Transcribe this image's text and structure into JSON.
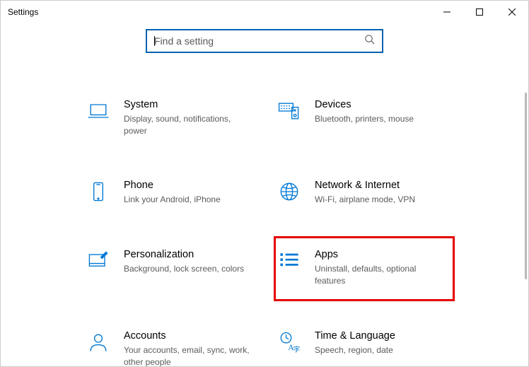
{
  "window": {
    "title": "Settings"
  },
  "search": {
    "placeholder": "Find a setting",
    "value": ""
  },
  "categories": [
    {
      "id": "system",
      "title": "System",
      "desc": "Display, sound, notifications, power",
      "icon": "laptop-icon"
    },
    {
      "id": "devices",
      "title": "Devices",
      "desc": "Bluetooth, printers, mouse",
      "icon": "keyboard-speaker-icon"
    },
    {
      "id": "phone",
      "title": "Phone",
      "desc": "Link your Android, iPhone",
      "icon": "phone-icon"
    },
    {
      "id": "network",
      "title": "Network & Internet",
      "desc": "Wi-Fi, airplane mode, VPN",
      "icon": "globe-icon"
    },
    {
      "id": "personalization",
      "title": "Personalization",
      "desc": "Background, lock screen, colors",
      "icon": "paintbrush-icon"
    },
    {
      "id": "apps",
      "title": "Apps",
      "desc": "Uninstall, defaults, optional features",
      "icon": "apps-list-icon",
      "highlighted": true
    },
    {
      "id": "accounts",
      "title": "Accounts",
      "desc": "Your accounts, email, sync, work, other people",
      "icon": "person-icon"
    },
    {
      "id": "time",
      "title": "Time & Language",
      "desc": "Speech, region, date",
      "icon": "time-lang-icon"
    }
  ],
  "colors": {
    "accent": "#0078d4",
    "highlight": "#e40000",
    "searchBorder": "#0062b1"
  }
}
